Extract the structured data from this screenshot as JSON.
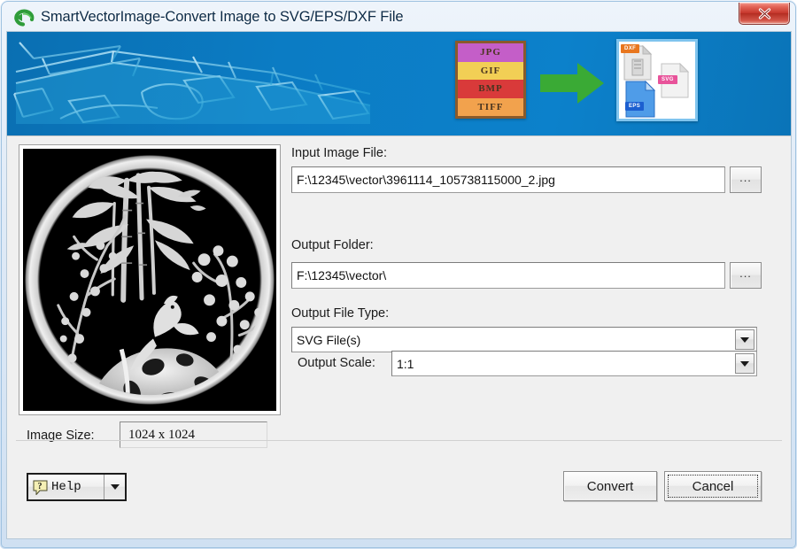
{
  "window": {
    "title": "SmartVectorImage-Convert Image to SVG/EPS/DXF File",
    "logo_icon": "green-circular-arrow-icon",
    "close_label": "x",
    "frame_color": "#cfe0f2"
  },
  "banner": {
    "background_color": "#0b79bf",
    "artwork": "blue-3d-wireframe-cad-drawing",
    "input_formats": [
      {
        "label": "JPG",
        "color": "#c45ec8"
      },
      {
        "label": "GIF",
        "color": "#f2cf55"
      },
      {
        "label": "BMP",
        "color": "#d93a3a"
      },
      {
        "label": "TIFF",
        "color": "#f2a24d"
      }
    ],
    "arrow_icon": "green-right-arrow-icon",
    "arrow_color": "#3aaa35",
    "output_formats": [
      {
        "label": "DXF",
        "color": "#e8761f"
      },
      {
        "label": "SVG",
        "color": "#e8539a"
      },
      {
        "label": "EPS",
        "color": "#1c5fd0"
      }
    ]
  },
  "preview": {
    "alt": "grayscale-relief-carving-bamboo-plum-blossom-birds-circular-medallion",
    "background_color": "#000000"
  },
  "form": {
    "input_file_label": "Input Image File:",
    "input_file_value": "F:\\12345\\vector\\3961114_105738115000_2.jpg",
    "input_file_browse_label": "...",
    "output_folder_label": "Output Folder:",
    "output_folder_value": "F:\\12345\\vector\\",
    "output_folder_browse_label": "...",
    "output_type_label": "Output File Type:",
    "output_type_value": "SVG File(s)",
    "output_scale_label": "Output Scale:",
    "output_scale_value": "1:1",
    "image_size_label": "Image Size:",
    "image_size_value": "1024 x 1024"
  },
  "footer": {
    "help_label": "Help",
    "help_icon": "question-mark-balloon-icon",
    "convert_label": "Convert",
    "cancel_label": "Cancel"
  }
}
